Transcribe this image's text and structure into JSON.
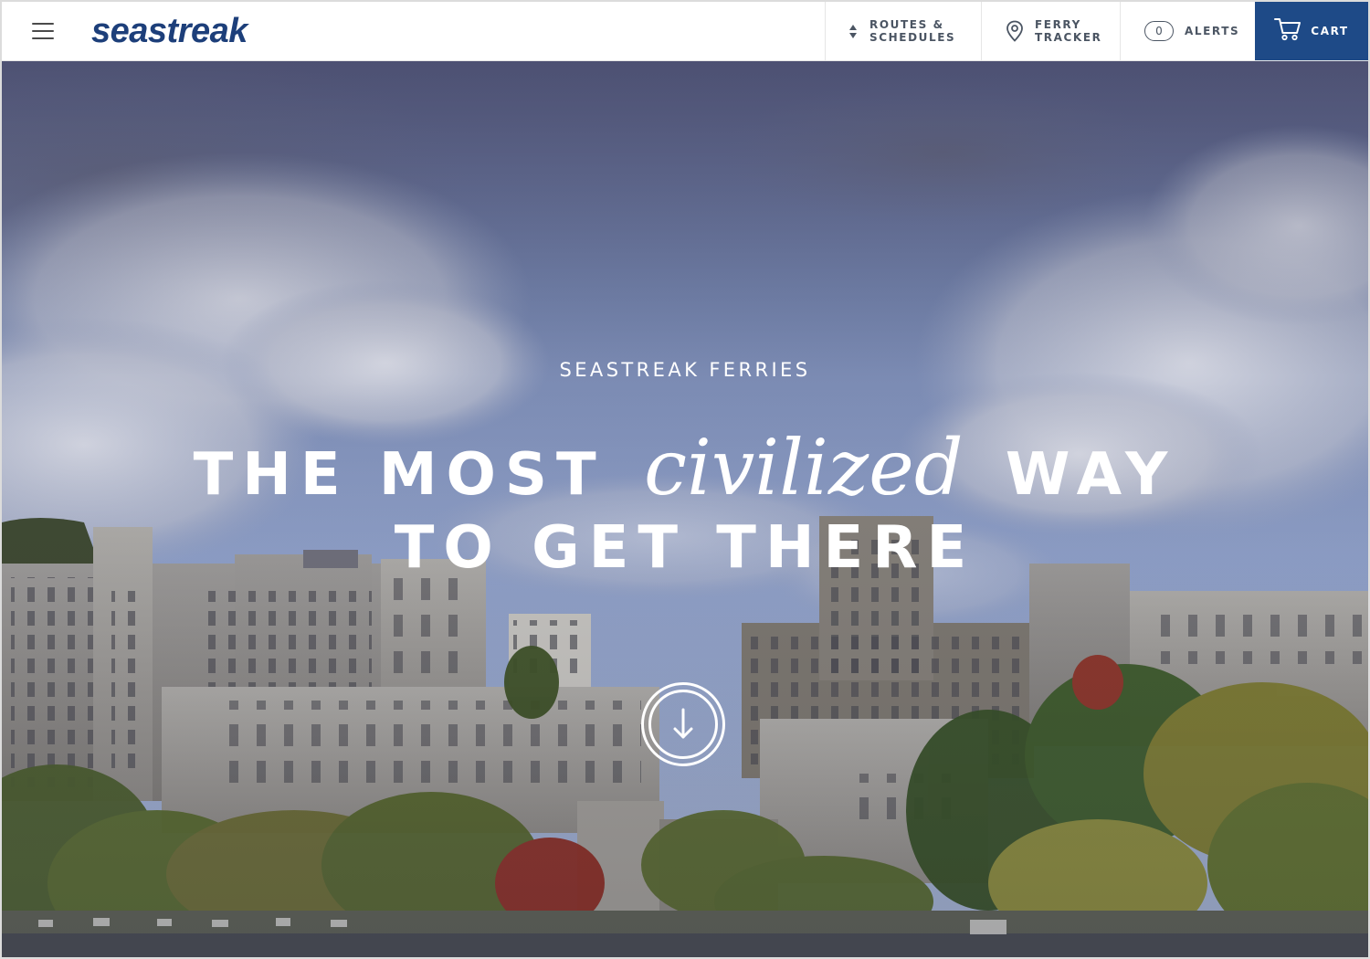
{
  "brand": {
    "logo_text": "seastreak",
    "primary_color": "#1e4a87",
    "logo_color": "#1d3f7a"
  },
  "header": {
    "menu_icon": "hamburger-menu-icon",
    "nav": [
      {
        "id": "routes",
        "line1": "ROUTES &",
        "line2": "SCHEDULES",
        "icon": "up-down-arrows-icon"
      },
      {
        "id": "tracker",
        "line1": "FERRY",
        "line2": "TRACKER",
        "icon": "map-pin-icon"
      },
      {
        "id": "alerts",
        "label": "ALERTS",
        "count": "0"
      }
    ],
    "cart": {
      "label": "CART",
      "icon": "shopping-cart-icon"
    }
  },
  "hero": {
    "kicker": "SEASTREAK FERRIES",
    "title_part1": "THE MOST",
    "title_accent": "civilized",
    "title_part2": "WAY",
    "title_line2": "TO GET THERE",
    "scroll_icon": "arrow-down-circle-icon"
  }
}
